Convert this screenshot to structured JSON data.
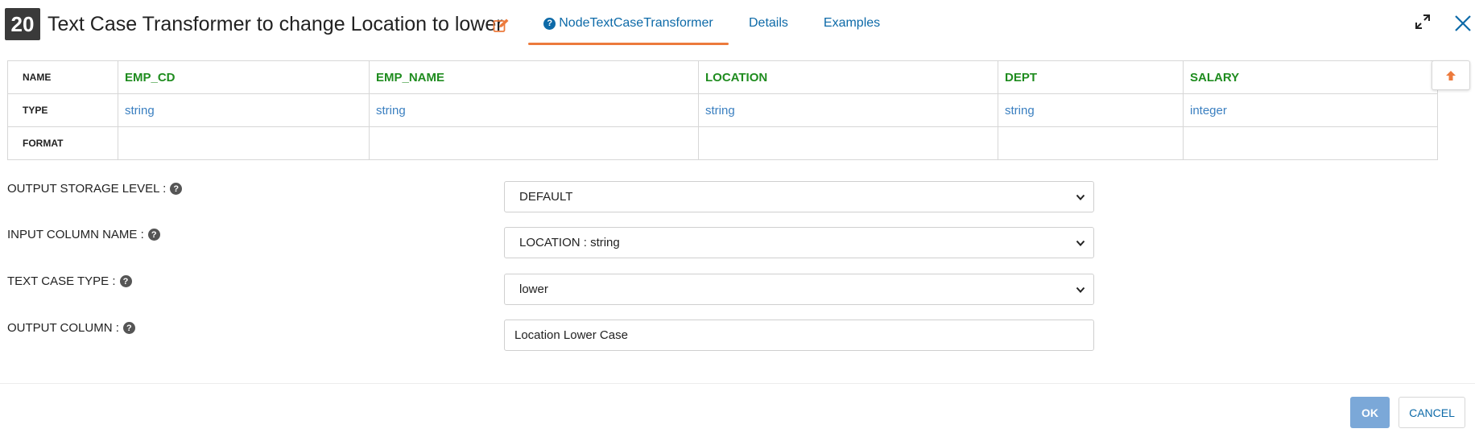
{
  "header": {
    "node_number": "20",
    "title": "Text Case Transformer to change Location to lower",
    "tabs": [
      {
        "label": "NodeTextCaseTransformer",
        "active": true
      },
      {
        "label": "Details",
        "active": false
      },
      {
        "label": "Examples",
        "active": false
      }
    ]
  },
  "schema": {
    "row_labels": {
      "name": "NAME",
      "type": "TYPE",
      "format": "FORMAT"
    },
    "columns": [
      {
        "name": "EMP_CD",
        "type": "string",
        "format": ""
      },
      {
        "name": "EMP_NAME",
        "type": "string",
        "format": ""
      },
      {
        "name": "LOCATION",
        "type": "string",
        "format": ""
      },
      {
        "name": "DEPT",
        "type": "string",
        "format": ""
      },
      {
        "name": "SALARY",
        "type": "integer",
        "format": ""
      }
    ]
  },
  "form": {
    "output_storage_level": {
      "label": "OUTPUT STORAGE LEVEL :",
      "value": "DEFAULT"
    },
    "input_column_name": {
      "label": "INPUT COLUMN NAME :",
      "value": "LOCATION : string"
    },
    "text_case_type": {
      "label": "TEXT CASE TYPE :",
      "value": "lower"
    },
    "output_column": {
      "label": "OUTPUT COLUMN :",
      "value": "Location Lower Case"
    }
  },
  "footer": {
    "ok_label": "OK",
    "cancel_label": "CANCEL"
  },
  "colors": {
    "accent_tab": "#ec7a3c",
    "link": "#0d6aa8",
    "column_name": "#1f8c1f",
    "column_type": "#3a7fc0",
    "ok_button": "#7ba8d8"
  },
  "icons": {
    "edit": "edit-icon",
    "help": "question-circle-icon",
    "expand": "expand-icon",
    "close": "close-icon",
    "scroll_up": "arrow-up-icon",
    "dropdown": "chevron-down-icon"
  }
}
